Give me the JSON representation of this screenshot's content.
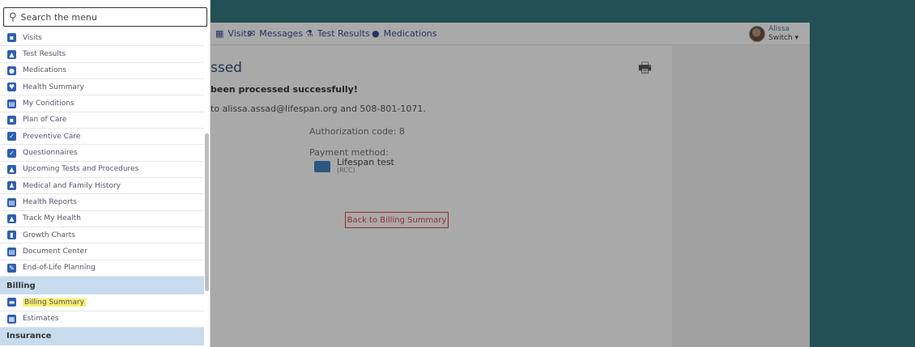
{
  "colors": {
    "teal": "#1f6b73",
    "nav_text": "#2a3a8a",
    "icon_blue": "#2f5fb0",
    "section_bg": "#c8dcee",
    "highlight": "#f6f06a",
    "accent_red": "#dd3333"
  },
  "search": {
    "placeholder": "Search the menu",
    "icon": "search-icon"
  },
  "menu": {
    "items": [
      {
        "label": "Visits",
        "icon": "calendar-icon"
      },
      {
        "label": "Test Results",
        "icon": "flask-icon"
      },
      {
        "label": "Medications",
        "icon": "pill-icon"
      },
      {
        "label": "Health Summary",
        "icon": "heart-icon"
      },
      {
        "label": "My Conditions",
        "icon": "clipboard-icon"
      },
      {
        "label": "Plan of Care",
        "icon": "plan-icon"
      },
      {
        "label": "Preventive Care",
        "icon": "shield-icon"
      },
      {
        "label": "Questionnaires",
        "icon": "checklist-icon"
      },
      {
        "label": "Upcoming Tests and Procedures",
        "icon": "flask-icon"
      },
      {
        "label": "Medical and Family History",
        "icon": "family-icon"
      },
      {
        "label": "Health Reports",
        "icon": "report-icon"
      },
      {
        "label": "Track My Health",
        "icon": "chart-icon"
      },
      {
        "label": "Growth Charts",
        "icon": "growth-icon"
      },
      {
        "label": "Document Center",
        "icon": "document-icon"
      },
      {
        "label": "End-of-Life Planning",
        "icon": "note-icon"
      }
    ],
    "billing_header": "Billing",
    "billing_items": [
      {
        "label": "Billing Summary",
        "icon": "billing-card-icon"
      },
      {
        "label": "Estimates",
        "icon": "calculator-icon"
      }
    ],
    "insurance_header": "Insurance"
  },
  "navbar": {
    "items": [
      {
        "label": "Visits",
        "icon": "calendar-icon"
      },
      {
        "label": "Messages",
        "icon": "envelope-icon"
      },
      {
        "label": "Test Results",
        "icon": "flask-icon"
      },
      {
        "label": "Medications",
        "icon": "pill-icon"
      }
    ],
    "user_name": "Alissa",
    "switch_label": "Switch ▾"
  },
  "content": {
    "heading": "ssed",
    "success": "been processed successfully!",
    "email_line": "to alissa.assad@lifespan.org and 508-801-1071.",
    "auth_code": "Authorization code: 8",
    "payment_method_label": "Payment method:",
    "card_name": "Lifespan test",
    "card_sub": "(RCC)",
    "back_button": "Back to Billing Summary"
  }
}
